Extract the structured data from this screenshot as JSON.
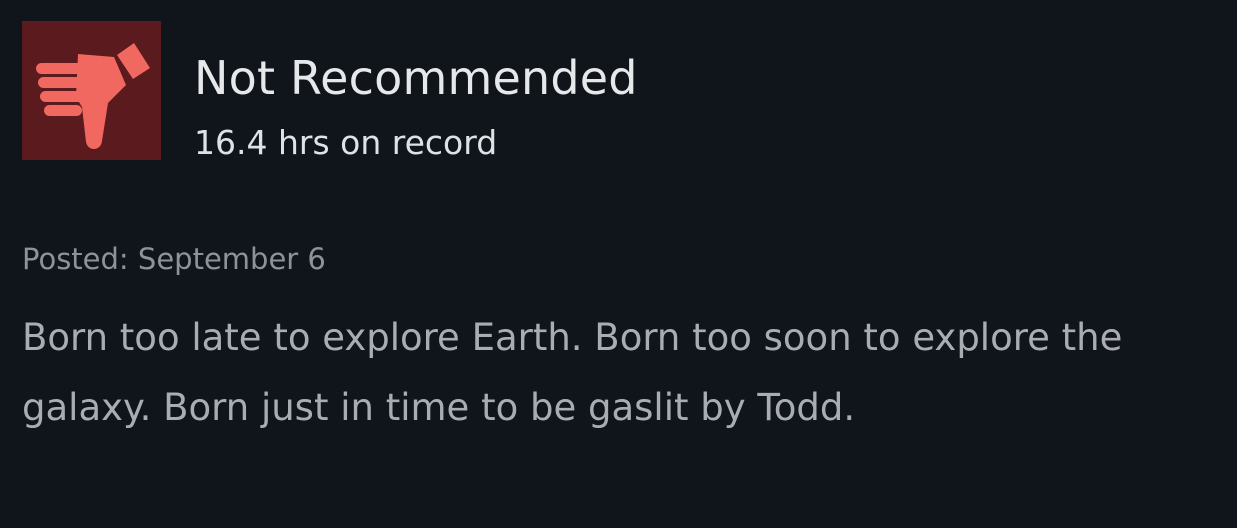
{
  "review": {
    "icon": "thumbs-down-icon",
    "icon_color": "#f0685f",
    "icon_bg": "#5b1a1e",
    "verdict": "Not Recommended",
    "hours": "16.4 hrs on record",
    "posted": "Posted: September 6",
    "body": "Born too late to explore Earth. Born too soon to explore the galaxy. Born just in time to be gaslit by Todd."
  }
}
